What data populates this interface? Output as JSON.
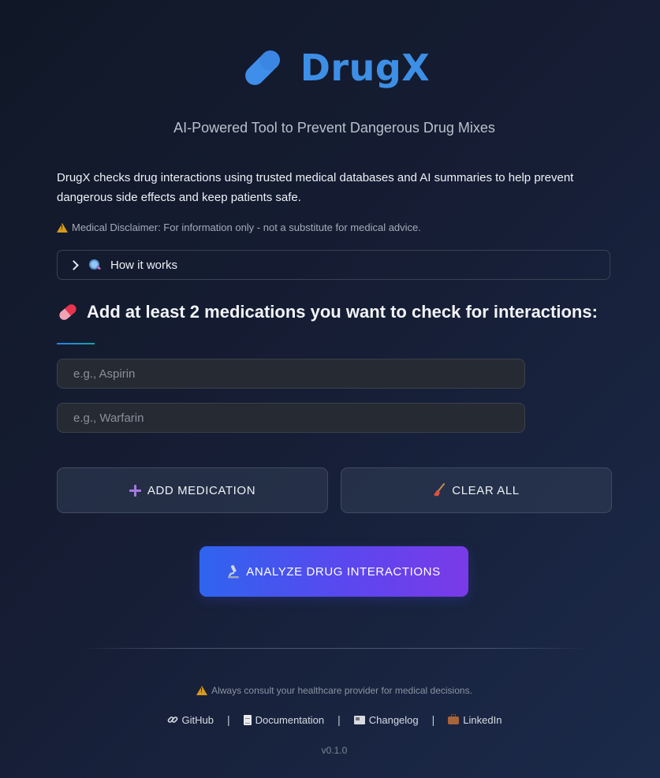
{
  "header": {
    "title": "DrugX",
    "tagline": "AI-Powered Tool to Prevent Dangerous Drug Mixes"
  },
  "intro": {
    "description": "DrugX checks drug interactions using trusted medical databases and AI summaries to help prevent dangerous side effects and keep patients safe.",
    "disclaimer": "Medical Disclaimer: For information only - not a substitute for medical advice."
  },
  "expander": {
    "label": "How it works"
  },
  "medications": {
    "heading": "Add at least 2 medications you want to check for interactions:",
    "fields": [
      {
        "value": "",
        "placeholder": "e.g., Aspirin"
      },
      {
        "value": "",
        "placeholder": "e.g., Warfarin"
      }
    ]
  },
  "actions": {
    "add_label": "ADD MEDICATION",
    "clear_label": "CLEAR ALL",
    "analyze_label": "ANALYZE DRUG INTERACTIONS"
  },
  "footer": {
    "note": "Always consult your healthcare provider for medical decisions.",
    "links": [
      {
        "label": "GitHub",
        "icon": "link-icon"
      },
      {
        "label": "Documentation",
        "icon": "document-icon"
      },
      {
        "label": "Changelog",
        "icon": "newspaper-icon"
      },
      {
        "label": "LinkedIn",
        "icon": "briefcase-icon"
      }
    ],
    "separator": "|",
    "version": "v0.1.0"
  },
  "colors": {
    "brand": "#3d8fe6",
    "analyze_gradient_start": "#2f64ef",
    "analyze_gradient_end": "#7a3ae8",
    "warning": "#d69a1e"
  }
}
